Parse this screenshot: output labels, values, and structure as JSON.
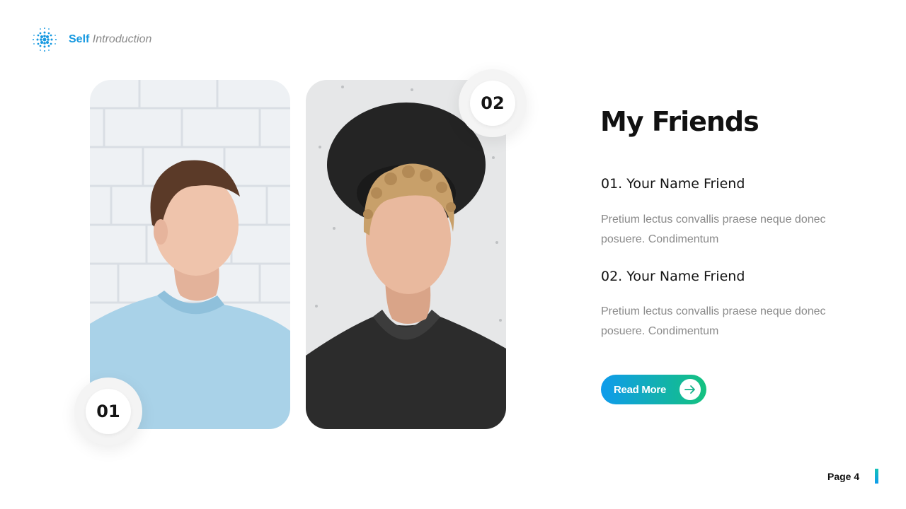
{
  "brand": {
    "bold": "Self",
    "italic": "Introduction",
    "logo_icon": "dotted-circle-icon",
    "accent_color": "#1598e0"
  },
  "photos": [
    {
      "badge": "01",
      "subject": "man in light blue t-shirt against white brick wall"
    },
    {
      "badge": "02",
      "subject": "young man with curly hair and black hat in dark t-shirt"
    }
  ],
  "main": {
    "title": "My Friends",
    "friends": [
      {
        "name": "01. Your Name Friend",
        "description": "Pretium lectus convallis praese neque donec posuere. Condimentum"
      },
      {
        "name": "02. Your Name Friend",
        "description": "Pretium lectus convallis praese neque donec posuere. Condimentum"
      }
    ],
    "button": {
      "label": "Read More",
      "icon": "arrow-right-icon",
      "gradient": [
        "#0f9bec",
        "#14c27f"
      ]
    }
  },
  "footer": {
    "page_label": "Page 4"
  }
}
